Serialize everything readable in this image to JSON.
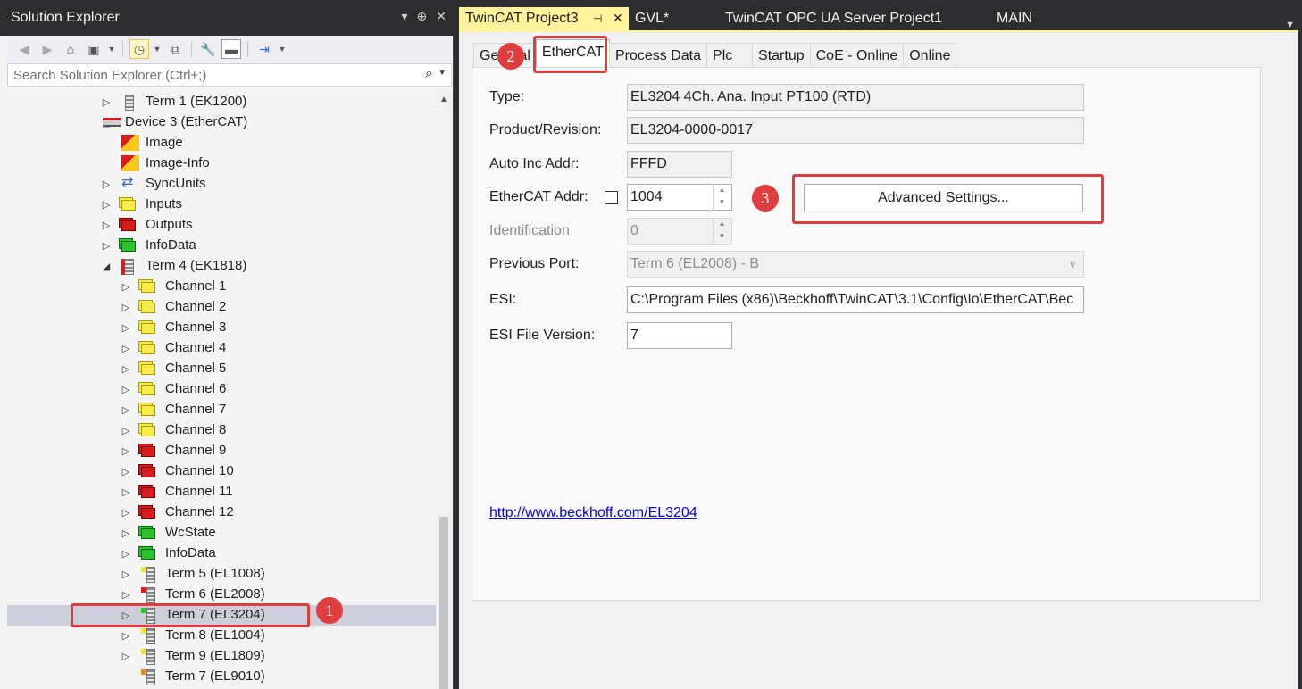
{
  "solution_explorer": {
    "title": "Solution Explorer",
    "title_buttons": [
      "▾",
      "⊕",
      "✕"
    ],
    "search_placeholder": "Search Solution Explorer (Ctrl+;)",
    "tree": [
      {
        "label": "Term 1 (EK1200)",
        "icon": "term-icon",
        "expand": "▷"
      },
      {
        "label": "Device 3 (EtherCAT)",
        "icon": "ethercat-device-icon",
        "expand": "◢"
      },
      {
        "label": "Image",
        "icon": "image-icon",
        "expand": ""
      },
      {
        "label": "Image-Info",
        "icon": "image-icon",
        "expand": ""
      },
      {
        "label": "SyncUnits",
        "icon": "syncunits-icon",
        "expand": "▷"
      },
      {
        "label": "Inputs",
        "icon": "inputs-icon",
        "expand": "▷"
      },
      {
        "label": "Outputs",
        "icon": "outputs-icon",
        "expand": "▷"
      },
      {
        "label": "InfoData",
        "icon": "infodata-icon",
        "expand": "▷"
      },
      {
        "label": "Term 4 (EK1818)",
        "icon": "ek1818-icon",
        "expand": "◢"
      },
      {
        "label": "Channel 1",
        "icon": "inputs-icon",
        "expand": "▷"
      },
      {
        "label": "Channel 2",
        "icon": "inputs-icon",
        "expand": "▷"
      },
      {
        "label": "Channel 3",
        "icon": "inputs-icon",
        "expand": "▷"
      },
      {
        "label": "Channel 4",
        "icon": "inputs-icon",
        "expand": "▷"
      },
      {
        "label": "Channel 5",
        "icon": "inputs-icon",
        "expand": "▷"
      },
      {
        "label": "Channel 6",
        "icon": "inputs-icon",
        "expand": "▷"
      },
      {
        "label": "Channel 7",
        "icon": "inputs-icon",
        "expand": "▷"
      },
      {
        "label": "Channel 8",
        "icon": "inputs-icon",
        "expand": "▷"
      },
      {
        "label": "Channel 9",
        "icon": "outputs-icon",
        "expand": "▷"
      },
      {
        "label": "Channel 10",
        "icon": "outputs-icon",
        "expand": "▷"
      },
      {
        "label": "Channel 11",
        "icon": "outputs-icon",
        "expand": "▷"
      },
      {
        "label": "Channel 12",
        "icon": "outputs-icon",
        "expand": "▷"
      },
      {
        "label": "WcState",
        "icon": "infodata-icon",
        "expand": "▷"
      },
      {
        "label": "InfoData",
        "icon": "infodata-icon",
        "expand": "▷"
      },
      {
        "label": "Term 5 (EL1008)",
        "icon": "term-icon",
        "expand": "▷",
        "flag": "#f5e23a"
      },
      {
        "label": "Term 6 (EL2008)",
        "icon": "term-icon",
        "expand": "▷",
        "flag": "#e01c1c"
      },
      {
        "label": "Term 7 (EL3204)",
        "icon": "term-icon",
        "expand": "▷",
        "flag": "#22d022"
      },
      {
        "label": "Term 8 (EL1004)",
        "icon": "term-icon",
        "expand": "▷",
        "flag": "#f5e23a"
      },
      {
        "label": "Term 9 (EL1809)",
        "icon": "term-icon",
        "expand": "▷",
        "flag": "#f5e23a"
      },
      {
        "label": "Term 7 (EL9010)",
        "icon": "term-icon",
        "expand": "",
        "flag": "#f08a1c"
      }
    ]
  },
  "document_tabs": [
    {
      "label": "TwinCAT Project3",
      "active": true
    },
    {
      "label": "GVL*",
      "active": false
    },
    {
      "label": "TwinCAT OPC UA Server Project1",
      "active": false
    },
    {
      "label": "MAIN",
      "active": false
    }
  ],
  "inner_tabs": [
    "General",
    "EtherCAT",
    "Process Data",
    "Plc",
    "Startup",
    "CoE - Online",
    "Online"
  ],
  "form": {
    "type_label": "Type:",
    "type_value": "EL3204 4Ch. Ana. Input PT100 (RTD)",
    "product_label": "Product/Revision:",
    "product_value": "EL3204-0000-0017",
    "autoinc_label": "Auto Inc Addr:",
    "autoinc_value": "FFFD",
    "ethercat_addr_label": "EtherCAT Addr:",
    "ethercat_addr_value": "1004",
    "identification_label": "Identification",
    "identification_value": "0",
    "prev_port_label": "Previous Port:",
    "prev_port_value": "Term 6 (EL2008) - B",
    "esi_label": "ESI:",
    "esi_value": "C:\\Program Files (x86)\\Beckhoff\\TwinCAT\\3.1\\Config\\Io\\EtherCAT\\Bec",
    "esi_version_label": "ESI File Version:",
    "esi_version_value": "7",
    "advanced_button": "Advanced Settings...",
    "link": "http://www.beckhoff.com/EL3204"
  },
  "annotations": {
    "badge1": "1",
    "badge2": "2",
    "badge3": "3",
    "color": "#e03e3e"
  }
}
